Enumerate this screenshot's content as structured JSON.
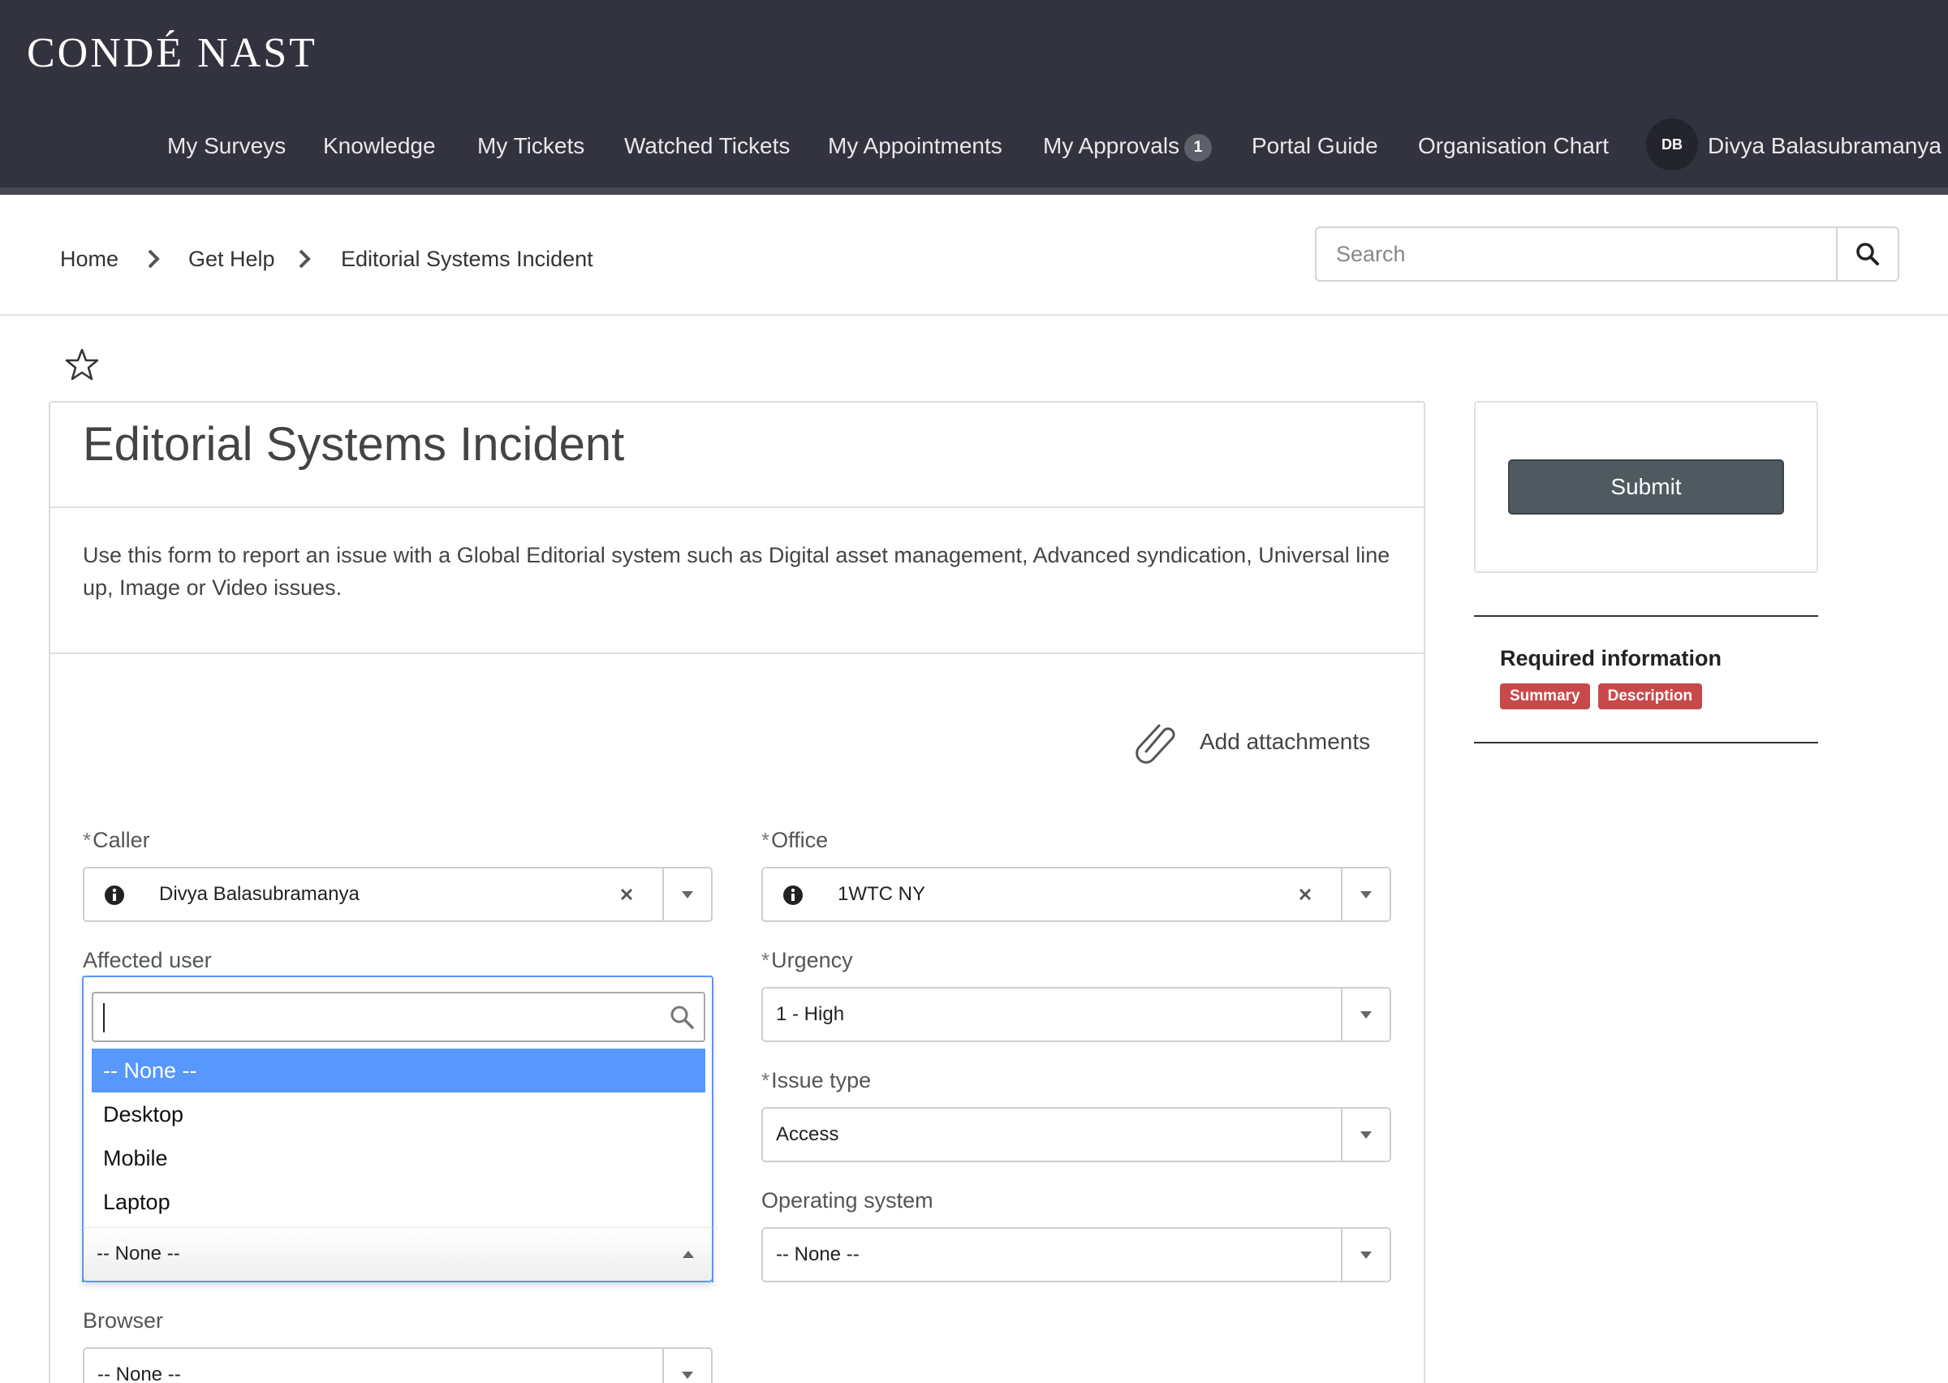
{
  "header": {
    "logo": "CONDÉ NAST",
    "nav": [
      {
        "label": "My Surveys"
      },
      {
        "label": "Knowledge"
      },
      {
        "label": "My Tickets"
      },
      {
        "label": "Watched Tickets"
      },
      {
        "label": "My Appointments"
      },
      {
        "label": "My Approvals",
        "badge": "1"
      },
      {
        "label": "Portal Guide"
      },
      {
        "label": "Organisation Chart"
      }
    ],
    "user": {
      "initials": "DB",
      "name": "Divya Balasubramanya"
    }
  },
  "breadcrumb": [
    "Home",
    "Get Help",
    "Editorial Systems Incident"
  ],
  "search": {
    "placeholder": "Search",
    "value": ""
  },
  "form": {
    "title": "Editorial Systems Incident",
    "description": "Use this form to report an issue with a Global Editorial system such as Digital asset management, Advanced syndication, Universal line up, Image or Video issues.",
    "attach_label": "Add attachments",
    "caller": {
      "label": "Caller",
      "required": "*",
      "value": "Divya Balasubramanya"
    },
    "office": {
      "label": "Office",
      "required": "*",
      "value": "1WTC NY"
    },
    "affected_user": {
      "label": "Affected user",
      "search_value": "",
      "options": [
        "-- None --",
        "Desktop",
        "Mobile",
        "Laptop"
      ],
      "selected_index": 0,
      "value": "-- None --"
    },
    "urgency": {
      "label": "Urgency",
      "required": "*",
      "value": "1 - High"
    },
    "issue_type": {
      "label": "Issue type",
      "required": "*",
      "value": "Access"
    },
    "operating_system": {
      "label": "Operating system",
      "value": "-- None --"
    },
    "browser": {
      "label": "Browser",
      "value": "-- None --"
    }
  },
  "sidebar": {
    "submit_label": "Submit",
    "required_title": "Required information",
    "required_tags": [
      "Summary",
      "Description"
    ]
  },
  "colors": {
    "header_bg": "#32333f",
    "accent": "#5897fb",
    "submit_bg": "#4f5a60",
    "tag_bg": "#c8494b"
  }
}
